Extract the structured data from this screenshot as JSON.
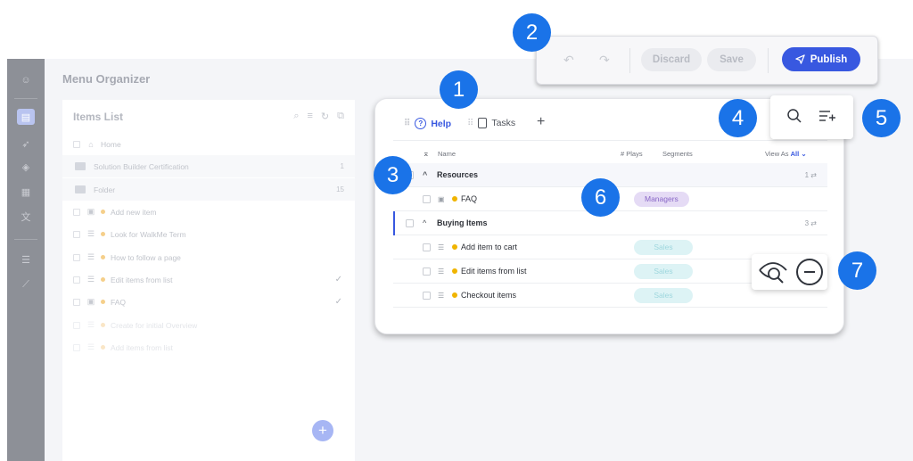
{
  "app": {
    "title": "Menu Organizer"
  },
  "rail": {
    "icons": [
      "logo-icon",
      "menu-organizer-icon",
      "rocket-icon",
      "layers-icon",
      "content-icon",
      "translate-icon",
      "list-icon",
      "analytics-icon"
    ]
  },
  "items_list": {
    "title": "Items List",
    "rows": [
      {
        "label": "Home",
        "kind": "home"
      },
      {
        "label": "Solution Builder Certification",
        "kind": "folder",
        "count": "1"
      },
      {
        "label": "Folder",
        "kind": "folder",
        "count": "15"
      },
      {
        "label": "Add new item",
        "kind": "item"
      },
      {
        "label": "Look for WalkMe Term",
        "kind": "item"
      },
      {
        "label": "How to follow a page",
        "kind": "item"
      },
      {
        "label": "Edit items from list",
        "kind": "item",
        "checked": true
      },
      {
        "label": "FAQ",
        "kind": "item",
        "checked": true
      },
      {
        "label": "Create for initial Overview",
        "kind": "item",
        "faded": true
      },
      {
        "label": "Add items from list",
        "kind": "item",
        "faded": true
      }
    ]
  },
  "toolbar": {
    "discard_label": "Discard",
    "save_label": "Save",
    "publish_label": "Publish"
  },
  "menu": {
    "tabs": [
      {
        "label": "Help",
        "active": true
      },
      {
        "label": "Tasks",
        "active": false
      }
    ],
    "columns": {
      "name": "Name",
      "plays": "# Plays",
      "segments": "Segments",
      "view_as": "View As",
      "view_as_value": "All"
    },
    "groups": [
      {
        "label": "Resources",
        "count": "1",
        "items": [
          {
            "label": "FAQ",
            "segment": "Managers",
            "segment_type": "manager"
          }
        ]
      },
      {
        "label": "Buying Items",
        "count": "3",
        "items": [
          {
            "label": "Add item to cart",
            "segment": "Sales",
            "segment_type": "sales"
          },
          {
            "label": "Edit items from list",
            "segment": "Sales",
            "segment_type": "sales"
          },
          {
            "label": "Checkout items",
            "segment": "Sales",
            "segment_type": "sales"
          }
        ]
      }
    ]
  },
  "markers": [
    "1",
    "2",
    "3",
    "4",
    "5",
    "6",
    "7"
  ],
  "colors": {
    "accent": "#3858e0",
    "marker": "#1a73e8",
    "dot": "#f0b400",
    "segment_manager_bg": "#e5dbf5",
    "segment_sales_bg": "#ddf3f5"
  }
}
